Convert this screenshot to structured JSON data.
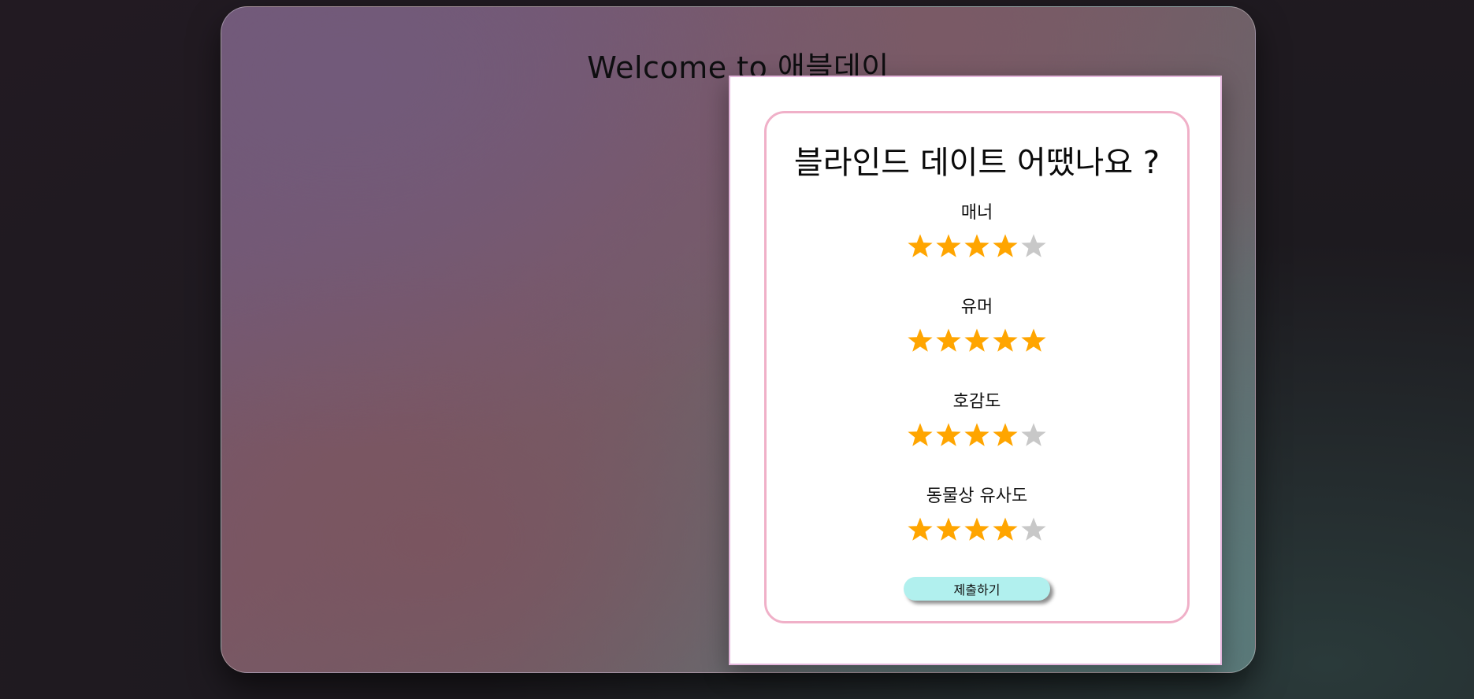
{
  "page": {
    "welcome_text": "Welcome to 애블데이"
  },
  "modal": {
    "title": "블라인드 데이트 어땠나요 ?",
    "categories": [
      {
        "label": "매너",
        "rating": 4,
        "max": 5
      },
      {
        "label": "유머",
        "rating": 5,
        "max": 5
      },
      {
        "label": "호감도",
        "rating": 4,
        "max": 5
      },
      {
        "label": "동물상 유사도",
        "rating": 4,
        "max": 5
      }
    ],
    "submit_label": "제출하기"
  },
  "colors": {
    "star_filled": "#FFA500",
    "star_empty": "#C8C8C8",
    "submit_bg": "#B1F0EE",
    "card_border": "#F0B0C8"
  },
  "icons": {
    "star": "star-icon"
  }
}
